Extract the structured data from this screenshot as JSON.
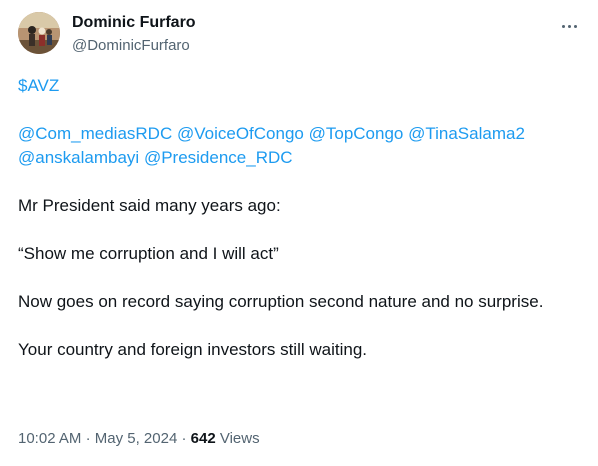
{
  "author": {
    "display_name": "Dominic Furfaro",
    "handle": "@DominicFurfaro",
    "avatar_icon": "profile-photo"
  },
  "tweet": {
    "cashtag": "$AVZ",
    "mentions_line1": [
      "@Com_mediasRDC",
      "@VoiceOfCongo",
      "@TopCongo",
      "@TinaSalama2"
    ],
    "mentions_line2": [
      "@anskalambayi",
      "@Presidence_RDC"
    ],
    "paragraph1": "Mr President said many years ago:",
    "paragraph2": "“Show me corruption and I will act”",
    "paragraph3": "Now goes on record saying corruption second nature and no surprise.",
    "paragraph4": "Your country and foreign investors still waiting."
  },
  "meta": {
    "time": "10:02 AM",
    "separator": "·",
    "date": "May 5, 2024",
    "views_count": "642",
    "views_label": "Views"
  },
  "colors": {
    "link": "#1d9bf0",
    "secondary_text": "#536471",
    "primary_text": "#0f1419"
  },
  "icons": {
    "more_menu": "more-horizontal-icon"
  }
}
